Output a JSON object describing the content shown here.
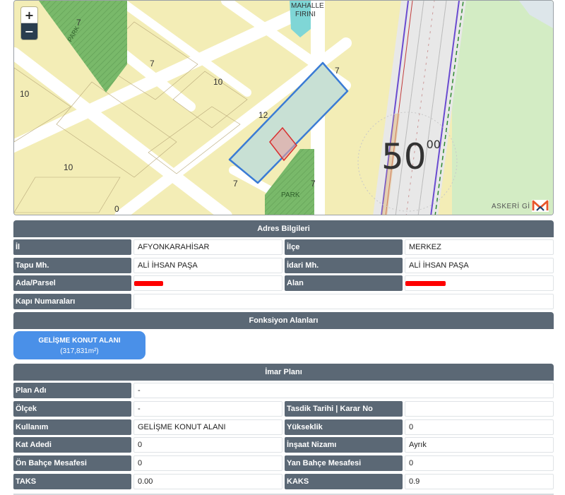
{
  "map": {
    "labels": {
      "mahalle": "MAHALLE",
      "firini": "FIRINI",
      "park_top": "PARK",
      "park_bottom": "PARK",
      "askeri": "ASKERİ Gİ",
      "big_number": "50",
      "big_number_sup": "00"
    },
    "elevations": [
      "7",
      "7",
      "10",
      "10",
      "12",
      "10",
      "0",
      "7",
      "7",
      "7"
    ],
    "zoom_in": "+",
    "zoom_out": "−",
    "logo_icon": "m-logo-icon"
  },
  "address": {
    "title": "Adres Bilgileri",
    "rows": [
      {
        "label1": "İl",
        "value1": "AFYONKARAHİSAR",
        "label2": "İlçe",
        "value2": "MERKEZ"
      },
      {
        "label1": "Tapu Mh.",
        "value1": "ALİ İHSAN PAŞA",
        "label2": "İdari Mh.",
        "value2": "ALİ İHSAN PAŞA"
      },
      {
        "label1": "Ada/Parsel",
        "value1": "",
        "label2": "Alan",
        "value2": ""
      }
    ],
    "door_label": "Kapı Numaraları",
    "door_value": ""
  },
  "function_areas": {
    "title": "Fonksiyon Alanları",
    "button_name": "GELİŞME KONUT ALANI",
    "button_area": "(317,831m²)"
  },
  "zoning": {
    "title": "İmar Planı",
    "plan_name_label": "Plan Adı",
    "plan_name_value": "-",
    "rows": [
      {
        "label1": "Ölçek",
        "value1": "-",
        "label2": "Tasdik Tarihi | Karar No",
        "value2": ""
      },
      {
        "label1": "Kullanım",
        "value1": "GELİŞME KONUT ALANI",
        "label2": "Yükseklik",
        "value2": "0"
      },
      {
        "label1": "Kat Adedi",
        "value1": "0",
        "label2": "İnşaat Nizamı",
        "value2": "Ayrık"
      },
      {
        "label1": "Ön Bahçe Mesafesi",
        "value1": "0",
        "label2": "Yan Bahçe Mesafesi",
        "value2": "0"
      },
      {
        "label1": "TAKS",
        "value1": "0.00",
        "label2": "KAKS",
        "value2": "0.9"
      }
    ]
  },
  "colors": {
    "header": "#5b6875",
    "accent_blue": "#4a90e8",
    "redaction": "#ff0000",
    "parcel_outline": "#3a7bd5"
  }
}
